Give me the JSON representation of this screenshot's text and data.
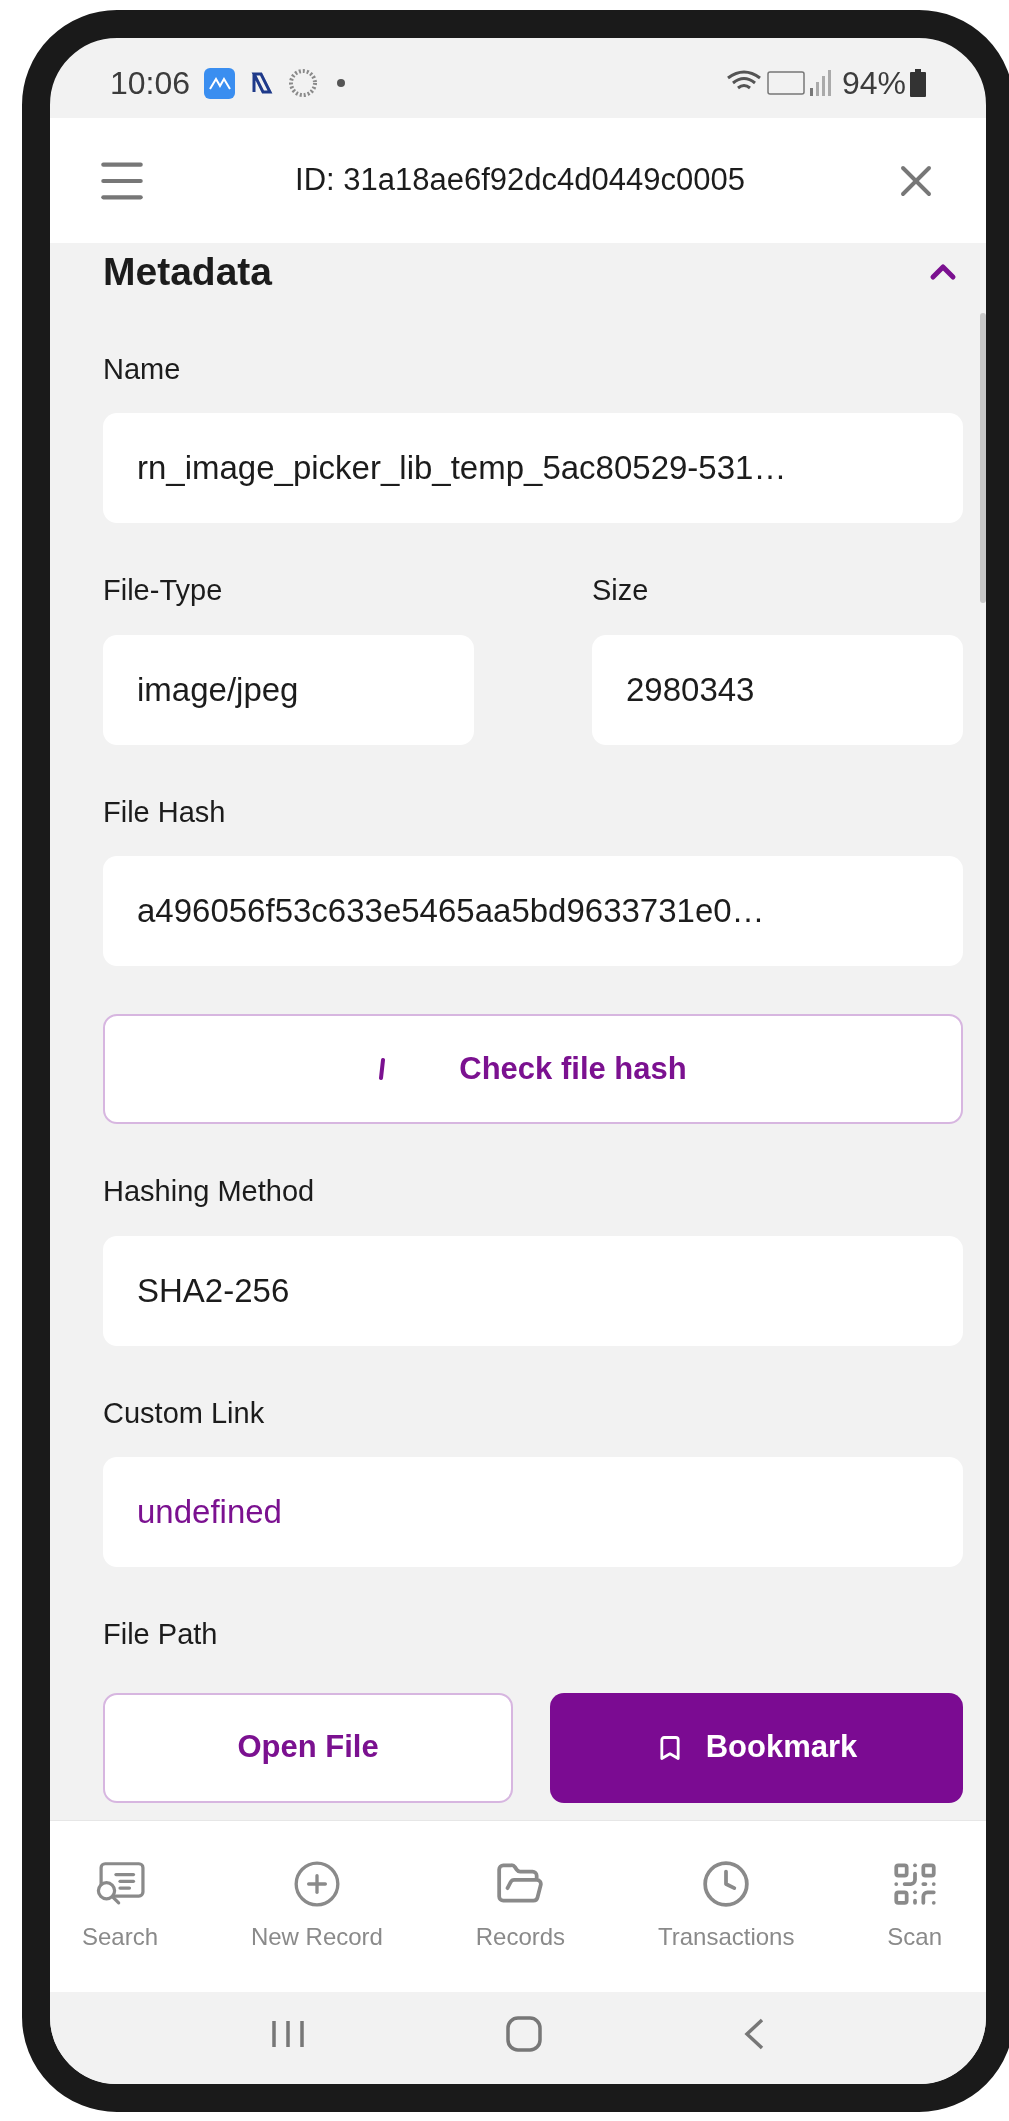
{
  "status_bar": {
    "time": "10:06",
    "battery": "94%"
  },
  "header": {
    "title": "ID: 31a18ae6f92dc4d0449c0005"
  },
  "section": {
    "title": "Metadata",
    "expanded": true
  },
  "items": [
    {
      "kind": "field",
      "label": "Name",
      "value": "rn_image_picker_lib_temp_5ac80529-531…"
    },
    {
      "kind": "pair",
      "fields": [
        {
          "label": "File-Type",
          "value": "image/jpeg"
        },
        {
          "label": "Size",
          "value": "2980343"
        }
      ]
    },
    {
      "kind": "field",
      "label": "File Hash",
      "value": "a496056f53c633e5465aa5bd9633731e0…"
    },
    {
      "kind": "button",
      "label": "Check file hash",
      "loading": true
    },
    {
      "kind": "field",
      "label": "Hashing Method",
      "value": "SHA2-256"
    },
    {
      "kind": "link",
      "label": "Custom Link",
      "value": "undefined"
    },
    {
      "kind": "label",
      "label": "File Path"
    }
  ],
  "actions": [
    {
      "label": "Open File",
      "primary": false
    },
    {
      "label": "Bookmark",
      "primary": true
    }
  ],
  "bottom_nav": [
    {
      "label": "Search"
    },
    {
      "label": "New Record"
    },
    {
      "label": "Records"
    },
    {
      "label": "Transactions"
    },
    {
      "label": "Scan"
    }
  ]
}
